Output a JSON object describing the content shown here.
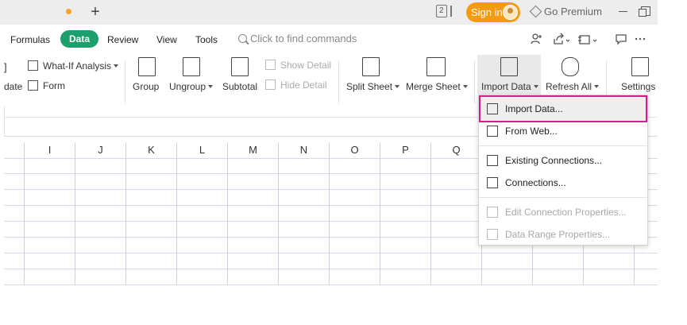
{
  "titlebar": {
    "window_count": "2",
    "signin_label": "Sign in",
    "premium_label": "Go Premium"
  },
  "menu": {
    "tabs": [
      {
        "label": "Formulas"
      },
      {
        "label": "Data",
        "active": true
      },
      {
        "label": "Review"
      },
      {
        "label": "View"
      },
      {
        "label": "Tools"
      }
    ],
    "search_placeholder": "Click to find commands"
  },
  "ribbon": {
    "left_bracket": "]",
    "date_fragment": "date",
    "whatif": "What-If Analysis",
    "form": "Form",
    "group": "Group",
    "ungroup": "Ungroup",
    "subtotal": "Subtotal",
    "show_detail": "Show Detail",
    "hide_detail": "Hide Detail",
    "split_sheet": "Split Sheet",
    "merge_sheet": "Merge Sheet",
    "import_data": "Import Data",
    "refresh_all": "Refresh All",
    "settings": "Settings"
  },
  "grid": {
    "columns": [
      "I",
      "J",
      "K",
      "L",
      "M",
      "N",
      "O",
      "P",
      "Q"
    ]
  },
  "dropdown": {
    "items": [
      {
        "label": "Import Data...",
        "icon": "import-data-icon",
        "enabled": true
      },
      {
        "label": "From Web...",
        "icon": "web-icon",
        "enabled": true
      },
      {
        "label": "Existing Connections...",
        "icon": "existing-connections-icon",
        "enabled": true
      },
      {
        "label": "Connections...",
        "icon": "connections-icon",
        "enabled": true
      },
      {
        "label": "Edit Connection Properties...",
        "icon": "edit-connection-icon",
        "enabled": false
      },
      {
        "label": "Data Range Properties...",
        "icon": "data-range-icon",
        "enabled": false
      }
    ]
  },
  "colors": {
    "accent_green": "#1d9e6d",
    "signin_orange": "#f39c12",
    "highlight_magenta": "#d0208a"
  }
}
